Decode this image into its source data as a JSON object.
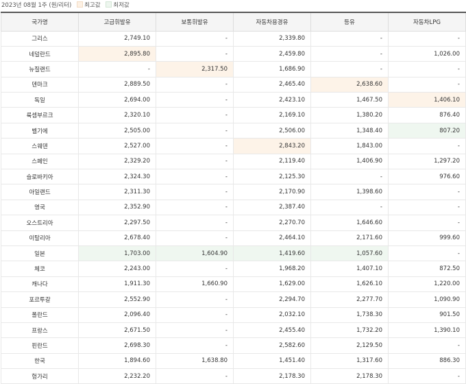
{
  "caption": {
    "period": "2023년 08월 1주 (원/리터)",
    "legend_high": "최고값",
    "legend_low": "최저값"
  },
  "colors": {
    "high": "#fdf3e8",
    "low": "#eff7f0",
    "header_bg": "#f5f5f5"
  },
  "columns": [
    "국가명",
    "고급휘발유",
    "보통휘발유",
    "자동차용경유",
    "등유",
    "자동차LPG"
  ],
  "rows": [
    {
      "country": "그리스",
      "values": [
        "2,749.10",
        "-",
        "2,339.80",
        "-",
        "-"
      ],
      "high": [],
      "low": []
    },
    {
      "country": "네덜란드",
      "values": [
        "2,895.80",
        "-",
        "2,459.80",
        "-",
        "1,026.00"
      ],
      "high": [
        0
      ],
      "low": []
    },
    {
      "country": "뉴질랜드",
      "values": [
        "-",
        "2,317.50",
        "1,686.90",
        "-",
        "-"
      ],
      "high": [
        1
      ],
      "low": []
    },
    {
      "country": "덴마크",
      "values": [
        "2,889.50",
        "-",
        "2,465.40",
        "2,638.60",
        "-"
      ],
      "high": [
        3
      ],
      "low": []
    },
    {
      "country": "독일",
      "values": [
        "2,694.00",
        "-",
        "2,423.10",
        "1,467.50",
        "1,406.10"
      ],
      "high": [
        4
      ],
      "low": []
    },
    {
      "country": "룩셈부르크",
      "values": [
        "2,320.10",
        "-",
        "2,169.10",
        "1,380.20",
        "876.40"
      ],
      "high": [],
      "low": []
    },
    {
      "country": "벨기에",
      "values": [
        "2,505.00",
        "-",
        "2,506.00",
        "1,348.40",
        "807.20"
      ],
      "high": [],
      "low": [
        4
      ]
    },
    {
      "country": "스웨덴",
      "values": [
        "2,527.00",
        "-",
        "2,843.20",
        "1,843.00",
        "-"
      ],
      "high": [
        2
      ],
      "low": []
    },
    {
      "country": "스페인",
      "values": [
        "2,329.20",
        "-",
        "2,119.40",
        "1,406.90",
        "1,297.20"
      ],
      "high": [],
      "low": []
    },
    {
      "country": "슬로바키아",
      "values": [
        "2,324.30",
        "-",
        "2,125.30",
        "-",
        "976.60"
      ],
      "high": [],
      "low": []
    },
    {
      "country": "아일랜드",
      "values": [
        "2,311.30",
        "-",
        "2,170.90",
        "1,398.60",
        "-"
      ],
      "high": [],
      "low": []
    },
    {
      "country": "영국",
      "values": [
        "2,352.90",
        "-",
        "2,387.40",
        "-",
        "-"
      ],
      "high": [],
      "low": []
    },
    {
      "country": "오스트리아",
      "values": [
        "2,297.50",
        "-",
        "2,270.70",
        "1,646.60",
        "-"
      ],
      "high": [],
      "low": []
    },
    {
      "country": "이탈리아",
      "values": [
        "2,678.40",
        "-",
        "2,464.10",
        "2,171.60",
        "999.60"
      ],
      "high": [],
      "low": []
    },
    {
      "country": "일본",
      "values": [
        "1,703.00",
        "1,604.90",
        "1,419.60",
        "1,057.60",
        "-"
      ],
      "high": [],
      "low": [
        0,
        1,
        2,
        3
      ]
    },
    {
      "country": "체코",
      "values": [
        "2,243.00",
        "-",
        "1,968.20",
        "1,407.10",
        "872.50"
      ],
      "high": [],
      "low": []
    },
    {
      "country": "캐나다",
      "values": [
        "1,911.30",
        "1,660.90",
        "1,629.00",
        "1,626.10",
        "1,220.00"
      ],
      "high": [],
      "low": []
    },
    {
      "country": "포르투갈",
      "values": [
        "2,552.90",
        "-",
        "2,294.70",
        "2,277.70",
        "1,090.90"
      ],
      "high": [],
      "low": []
    },
    {
      "country": "폴란드",
      "values": [
        "2,096.40",
        "-",
        "2,032.10",
        "1,738.30",
        "901.50"
      ],
      "high": [],
      "low": []
    },
    {
      "country": "프랑스",
      "values": [
        "2,671.50",
        "-",
        "2,455.40",
        "1,732.20",
        "1,390.10"
      ],
      "high": [],
      "low": []
    },
    {
      "country": "핀란드",
      "values": [
        "2,698.30",
        "-",
        "2,582.60",
        "2,129.50",
        "-"
      ],
      "high": [],
      "low": []
    },
    {
      "country": "한국",
      "values": [
        "1,894.60",
        "1,638.80",
        "1,451.40",
        "1,317.60",
        "886.30"
      ],
      "high": [],
      "low": []
    },
    {
      "country": "헝가리",
      "values": [
        "2,232.20",
        "-",
        "2,178.30",
        "2,178.30",
        "-"
      ],
      "high": [],
      "low": []
    }
  ]
}
